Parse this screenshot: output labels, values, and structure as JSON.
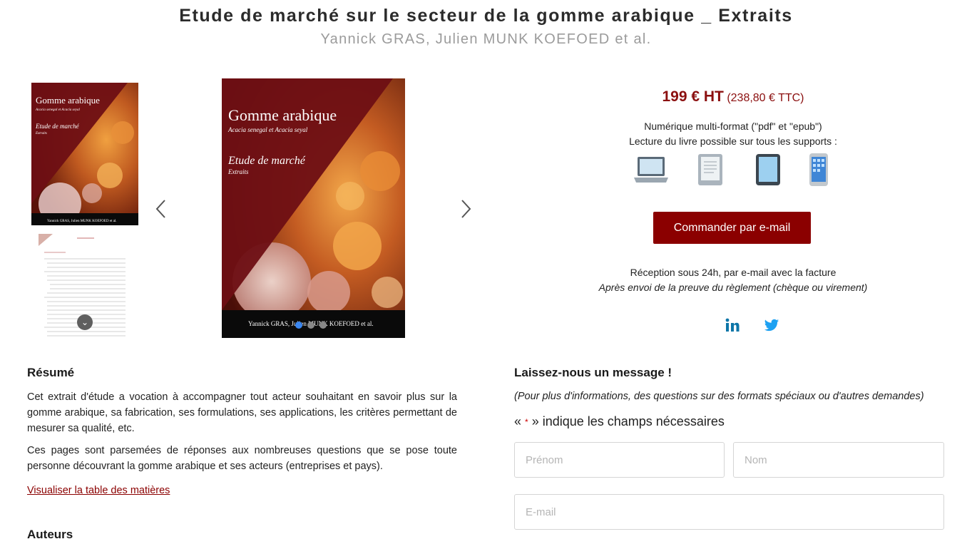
{
  "header": {
    "title": "Etude de marché sur le secteur de la gomme arabique _ Extraits",
    "authors": "Yannick GRAS, Julien MUNK KOEFOED et al."
  },
  "cover": {
    "title": "Gomme arabique",
    "subtitle": "Acacia senegal et Acacia seyal",
    "study": "Etude de marché",
    "extract": "Extraits",
    "authors": "Yannick GRAS, Julien MUNK KOEFOED et al.",
    "thumb_subtitle": "Acacia senegal et Acacia seyal",
    "colors": {
      "dark_red": "#6e0f14",
      "black": "#0a0a0a"
    }
  },
  "gallery": {
    "slides": 3,
    "active_slide": 1
  },
  "purchase": {
    "price_ht": "199 € HT",
    "price_ttc": "(238,80 € TTC)",
    "format_line": "Numérique multi-format (\"pdf\" et \"epub\")",
    "support_line": "Lecture du livre possible sur tous les supports :",
    "devices": [
      "laptop-icon",
      "ereader-icon",
      "tablet-icon",
      "smartphone-icon"
    ],
    "order_button": "Commander par e-mail",
    "reception_line": "Réception sous 24h, par e-mail avec la facture",
    "payment_line": "Après envoi de la preuve du règlement (chèque ou virement)",
    "social": [
      "linkedin-icon",
      "twitter-icon"
    ],
    "accent": "#8b0000"
  },
  "summary": {
    "heading": "Résumé",
    "paragraph1": "Cet extrait d'étude a vocation à accompagner tout acteur souhaitant en savoir plus sur la gomme arabique, sa fabrication, ses formulations, ses applications, les critères permettant de mesurer sa qualité, etc.",
    "paragraph2": "Ces pages sont parsemées de réponses aux nombreuses questions que se pose toute personne découvrant la gomme arabique et ses acteurs (entreprises et pays).",
    "toc_link": "Visualiser la table des matières",
    "authors_heading": "Auteurs"
  },
  "contact": {
    "heading": "Laissez-nous un message !",
    "note": "(Pour plus d'informations, des questions sur des formats spéciaux ou d'autres demandes)",
    "required_open": "«",
    "required_star": "*",
    "required_close": "» indique les champs nécessaires",
    "firstname_placeholder": "Prénom",
    "lastname_placeholder": "Nom",
    "email_placeholder": "E-mail"
  }
}
